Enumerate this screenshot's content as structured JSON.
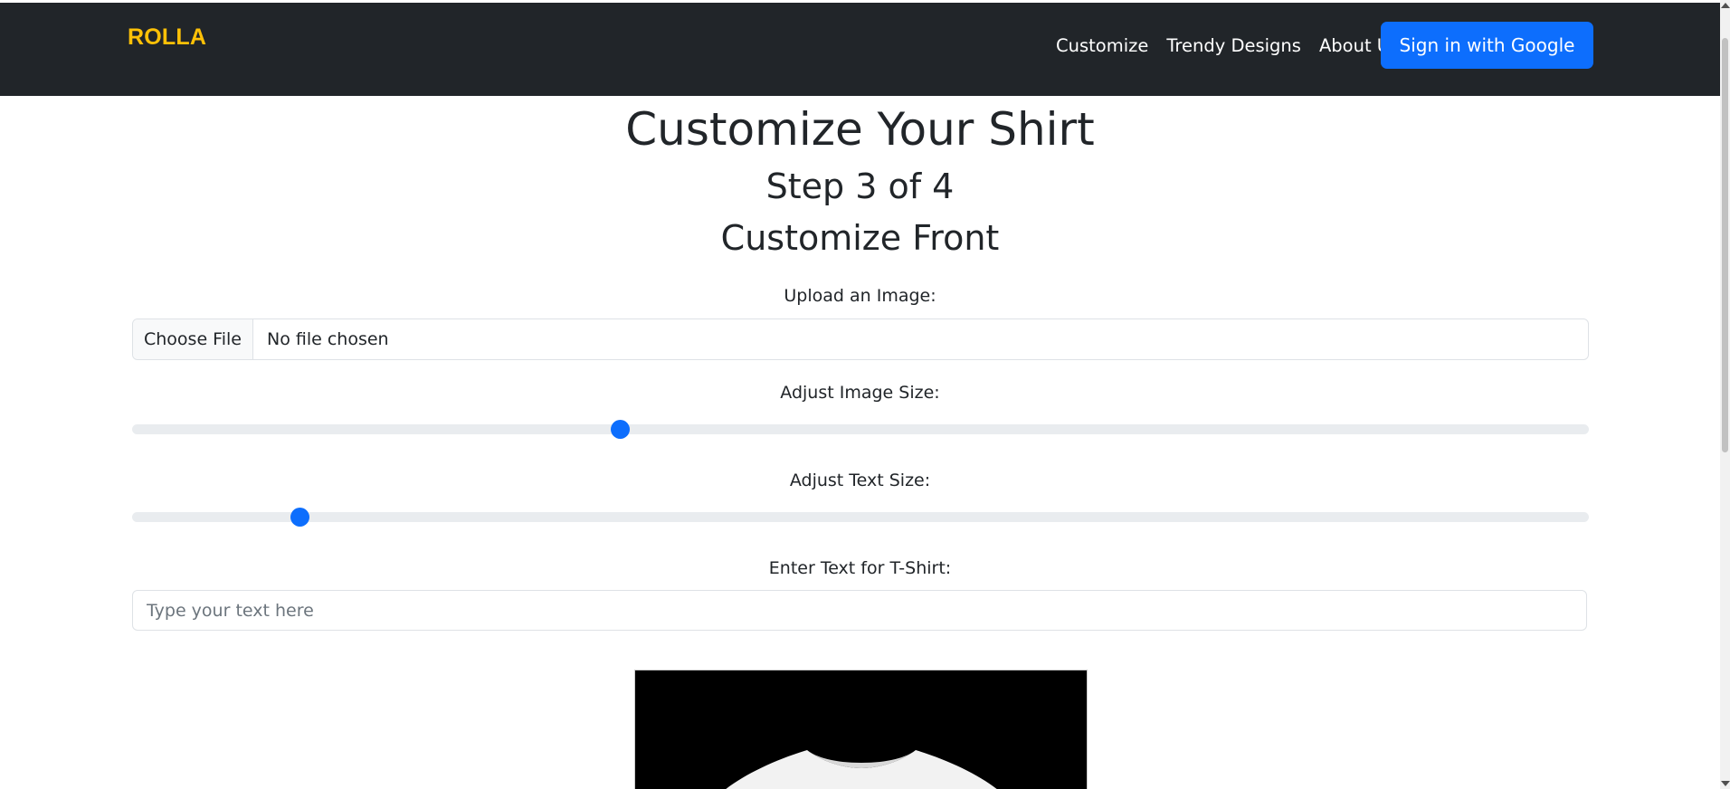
{
  "navbar": {
    "brand": "ROLLA",
    "links": [
      "Customize",
      "Trendy Designs",
      "About Us"
    ],
    "signin_label": "Sign in with Google"
  },
  "main": {
    "title": "Customize Your Shirt",
    "step": "Step 3 of 4",
    "section": "Customize Front",
    "upload_label": "Upload an Image:",
    "file_button": "Choose File",
    "file_status": "No file chosen",
    "image_size_label": "Adjust Image Size:",
    "image_size_level": 0.335,
    "text_size_label": "Adjust Text Size:",
    "text_size_level": 0.115,
    "text_label": "Enter Text for T-Shirt:",
    "text_placeholder": "Type your text here",
    "text_value": ""
  },
  "colors": {
    "navbar_bg": "#212529",
    "brand": "#ffc107",
    "primary": "#0d6efd"
  },
  "icons": [
    "tshirt-preview-image"
  ]
}
